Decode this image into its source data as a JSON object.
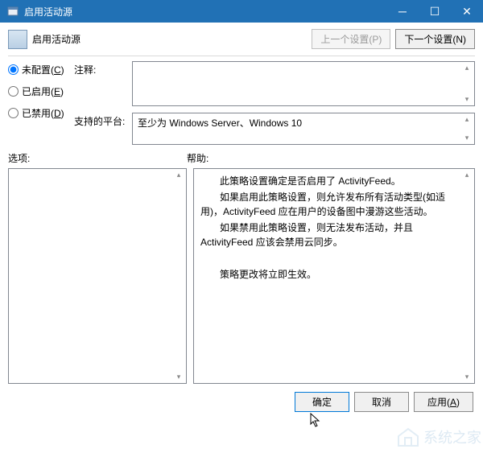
{
  "window": {
    "title": "启用活动源"
  },
  "header": {
    "title": "启用活动源",
    "prev_btn": "上一个设置(P)",
    "next_btn": "下一个设置(N)"
  },
  "radios": {
    "not_configured": "未配置(",
    "not_configured_key": "C",
    "not_configured_end": ")",
    "enabled": "已启用(",
    "enabled_key": "E",
    "enabled_end": ")",
    "disabled": "已禁用(",
    "disabled_key": "D",
    "disabled_end": ")"
  },
  "labels": {
    "comment": "注释:",
    "supported": "支持的平台:",
    "options": "选项:",
    "help": "帮助:"
  },
  "supported_text": "至少为 Windows Server、Windows 10",
  "help": {
    "l1": "此策略设置确定是否启用了 ActivityFeed。",
    "l2": "如果启用此策略设置，则允许发布所有活动类型(如适用)，ActivityFeed 应在用户的设备图中漫游这些活动。",
    "l3": "如果禁用此策略设置，则无法发布活动，并且 ActivityFeed 应该会禁用云同步。",
    "l4": "策略更改将立即生效。"
  },
  "footer": {
    "ok": "确定",
    "cancel": "取消",
    "apply": "应用(",
    "apply_key": "A",
    "apply_end": ")"
  },
  "watermark": "系统之家"
}
